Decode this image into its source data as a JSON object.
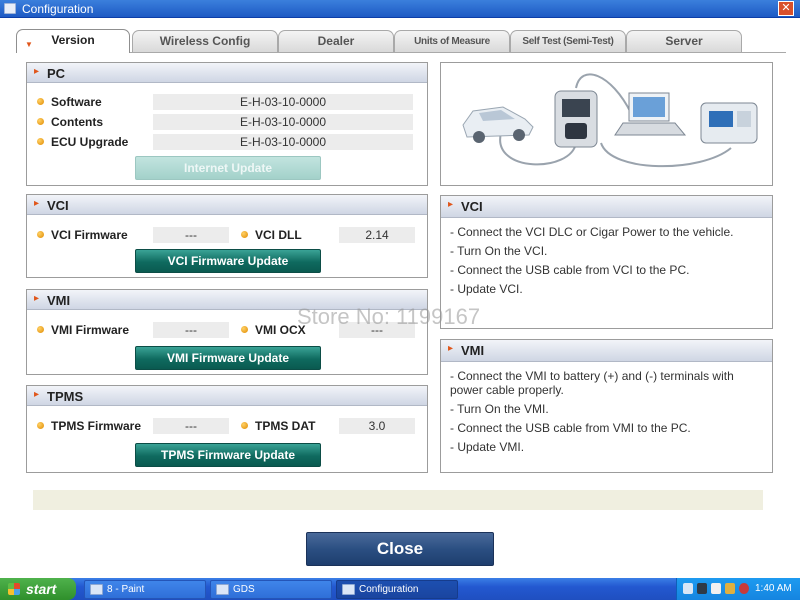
{
  "window": {
    "title": "Configuration",
    "close_glyph": "✕"
  },
  "tabs": [
    {
      "label": "Version",
      "active": true
    },
    {
      "label": "Wireless Config"
    },
    {
      "label": "Dealer"
    },
    {
      "label": "Units of Measure"
    },
    {
      "label": "Self Test (Semi-Test)"
    },
    {
      "label": "Server"
    }
  ],
  "pc": {
    "title": "PC",
    "rows": [
      {
        "label": "Software",
        "value": "E-H-03-10-0000"
      },
      {
        "label": "Contents",
        "value": "E-H-03-10-0000"
      },
      {
        "label": "ECU Upgrade",
        "value": "E-H-03-10-0000"
      }
    ],
    "button": "Internet Update"
  },
  "vci": {
    "title": "VCI",
    "firmware_label": "VCI Firmware",
    "firmware_value": "---",
    "dll_label": "VCI DLL",
    "dll_value": "2.14",
    "button": "VCI Firmware Update"
  },
  "vmi": {
    "title": "VMI",
    "firmware_label": "VMI Firmware",
    "firmware_value": "---",
    "ocx_label": "VMI OCX",
    "ocx_value": "---",
    "button": "VMI Firmware Update"
  },
  "tpms": {
    "title": "TPMS",
    "firmware_label": "TPMS Firmware",
    "firmware_value": "---",
    "dat_label": "TPMS DAT",
    "dat_value": "3.0",
    "button": "TPMS Firmware Update"
  },
  "vci_info": {
    "title": "VCI",
    "lines": [
      "- Connect the VCI DLC or Cigar Power to the vehicle.",
      "- Turn On the VCI.",
      "- Connect the USB cable from VCI to the PC.",
      "- Update VCI."
    ]
  },
  "vmi_info": {
    "title": "VMI",
    "lines": [
      "- Connect the VMI to battery (+) and (-) terminals with power cable properly.",
      "- Turn On the VMI.",
      "- Connect the USB cable from VMI to the PC.",
      "- Update VMI."
    ]
  },
  "watermark": "Store No: 1199167",
  "close_button": "Close",
  "taskbar": {
    "start": "start",
    "items": [
      {
        "label": "8 - Paint"
      },
      {
        "label": "GDS"
      },
      {
        "label": "Configuration",
        "active": true
      }
    ],
    "clock": "1:40 AM"
  },
  "colors": {
    "accent_orange": "#e0561b",
    "button_teal": "#0f6a5f",
    "close_blue": "#2b4f82"
  }
}
